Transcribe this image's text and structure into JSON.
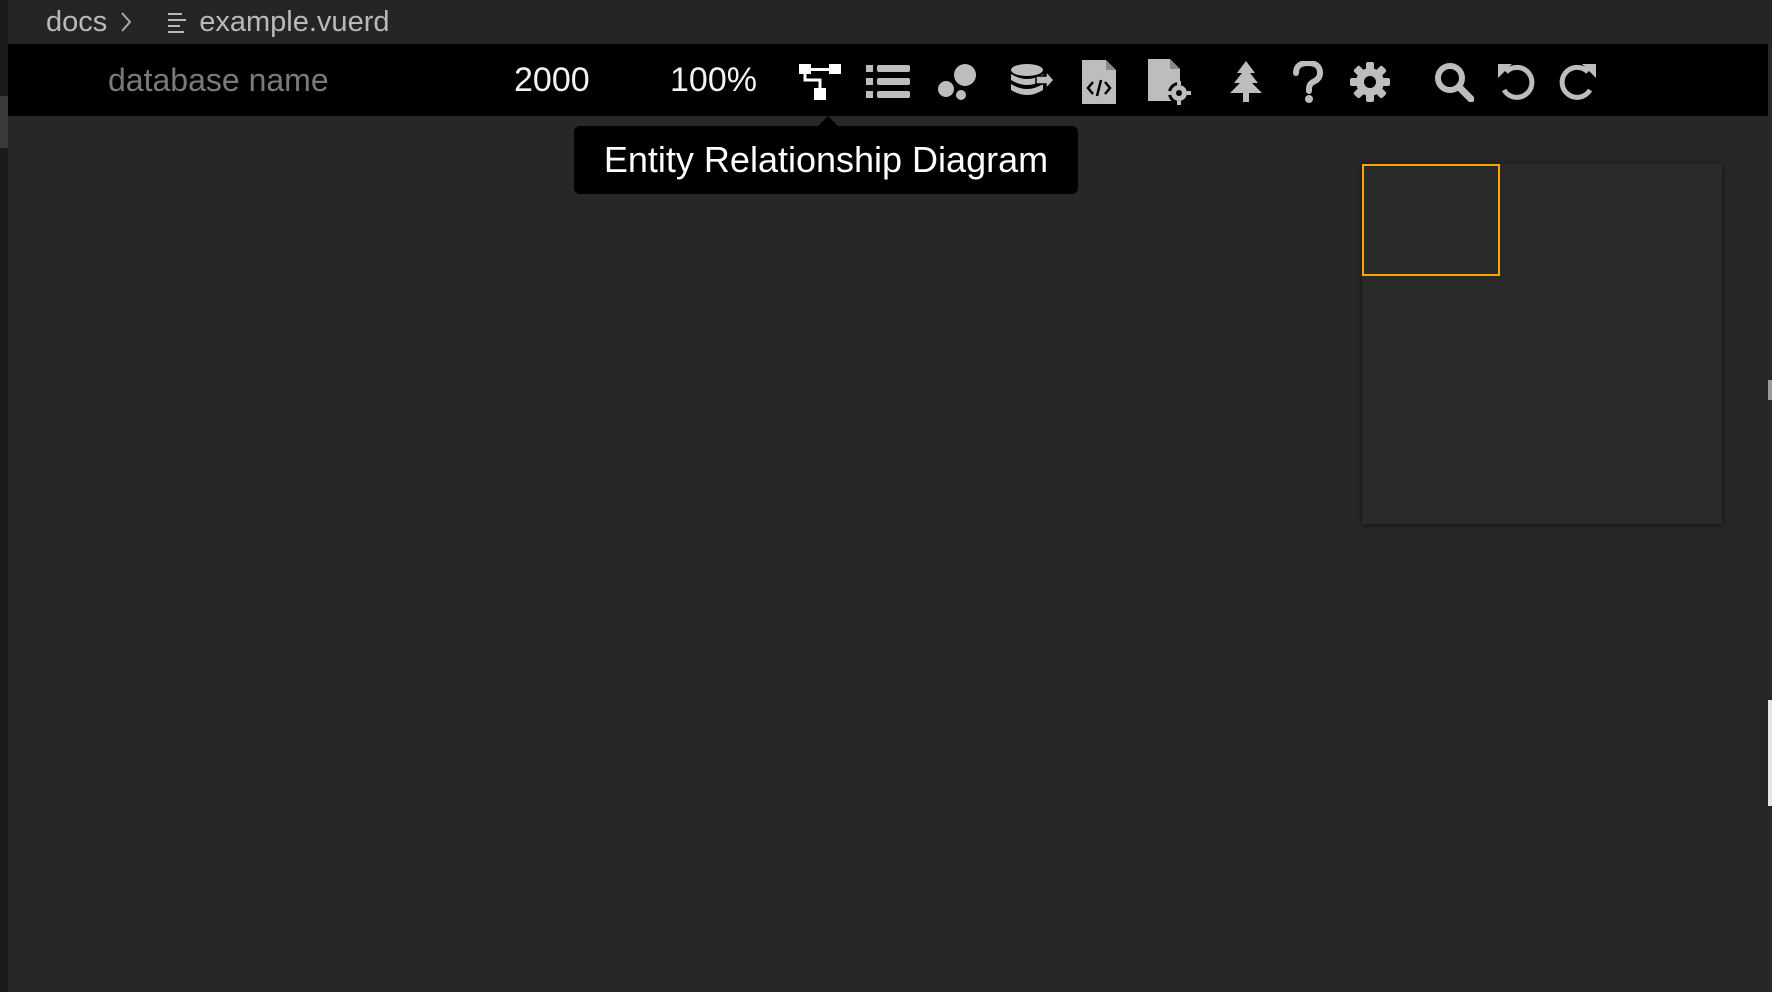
{
  "breadcrumb": {
    "root": "docs",
    "file": "example.vuerd"
  },
  "toolbar": {
    "database_name_placeholder": "database name",
    "canvas_size": "2000",
    "zoom_level": "100%",
    "tools": [
      {
        "name": "erd-icon",
        "label": "Entity Relationship Diagram",
        "active": true
      },
      {
        "name": "list-icon"
      },
      {
        "name": "visualization-icon"
      },
      {
        "name": "database-import-icon"
      },
      {
        "name": "export-code-file-icon"
      },
      {
        "name": "file-settings-icon"
      },
      {
        "name": "tree-icon"
      },
      {
        "name": "help-icon"
      },
      {
        "name": "settings-gear-icon"
      },
      {
        "name": "search-icon"
      },
      {
        "name": "undo-icon"
      },
      {
        "name": "redo-icon"
      }
    ]
  },
  "tooltip": {
    "text": "Entity Relationship Diagram"
  },
  "colors": {
    "background": "#272727",
    "toolbar": "#000000",
    "icon_active": "#ffffff",
    "icon_inactive": "#bdbdbd",
    "minimap_viewport": "#ffa500"
  }
}
